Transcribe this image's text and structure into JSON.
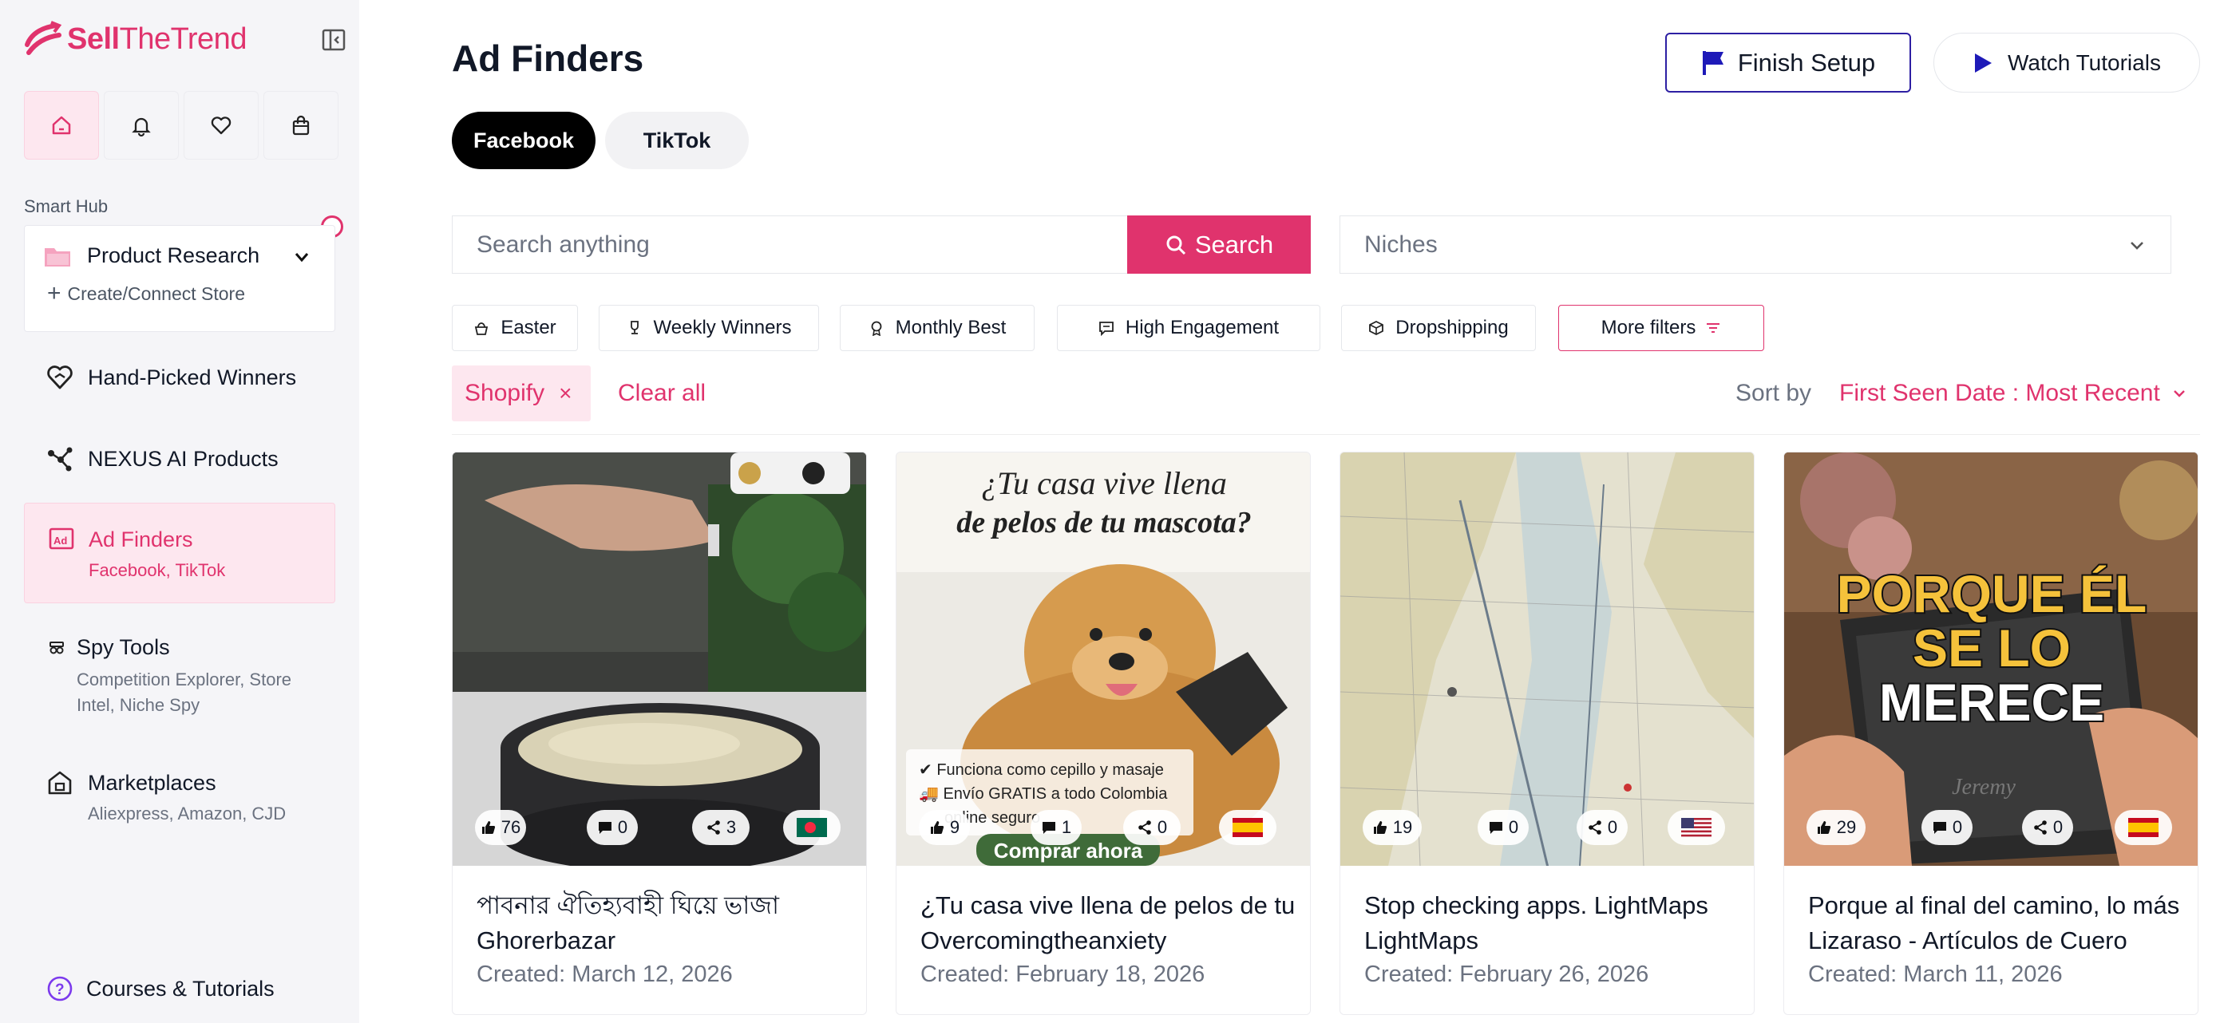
{
  "brand": {
    "logo_text_bold": "Sell",
    "logo_text_thin": "TheTrend"
  },
  "sidebar": {
    "smart_hub_label": "Smart Hub",
    "product_research": {
      "title": "Product Research",
      "sub": "Create/Connect Store"
    },
    "items": [
      {
        "title": "Hand-Picked Winners",
        "sub": ""
      },
      {
        "title": "NEXUS AI Products",
        "sub": ""
      },
      {
        "title": "Ad Finders",
        "sub": "Facebook, TikTok"
      },
      {
        "title": "Spy Tools",
        "sub": "Competition Explorer, Store Intel, Niche Spy"
      },
      {
        "title": "Marketplaces",
        "sub": "Aliexpress, Amazon, CJD"
      },
      {
        "title": "Courses & Tutorials",
        "sub": ""
      }
    ]
  },
  "header": {
    "title": "Ad Finders",
    "finish_setup": "Finish Setup",
    "watch_tutorials": "Watch Tutorials"
  },
  "tabs": [
    "Facebook",
    "TikTok"
  ],
  "search": {
    "placeholder": "Search anything",
    "button": "Search",
    "niches_placeholder": "Niches"
  },
  "chips": [
    "Easter",
    "Weekly Winners",
    "Monthly Best",
    "High Engagement",
    "Dropshipping",
    "More filters"
  ],
  "active_filter": {
    "label": "Shopify",
    "remove": "×"
  },
  "clear_all": "Clear all",
  "sort": {
    "label": "Sort by",
    "value": "First Seen Date : Most Recent"
  },
  "cards": [
    {
      "likes": "76",
      "comments": "0",
      "shares": "3",
      "country": "Bangladesh",
      "title_line1": "পাবনার ঐতিহ্যবাহী ঘিয়ে ভাজা",
      "title_line2": "Ghorerbazar",
      "date": "Created: March 12, 2026"
    },
    {
      "likes": "9",
      "comments": "1",
      "shares": "0",
      "country": "Spain",
      "title_line1": "¿Tu casa vive llena de pelos de tu",
      "title_line2": "Overcomingtheanxiety",
      "date": "Created: February 18, 2026",
      "overlay": {
        "headline_1": "¿Tu casa vive llena",
        "headline_2": "de pelos de tu mascota?",
        "bullet_1": "Funciona como cepillo y masaje",
        "bullet_2": "Envío GRATIS a todo Colombia",
        "bullet_3": "online seguro",
        "cta": "Comprar ahora"
      }
    },
    {
      "likes": "19",
      "comments": "0",
      "shares": "0",
      "country": "United States",
      "title_line1": "Stop checking apps. LightMaps",
      "title_line2": "LightMaps",
      "date": "Created: February 26, 2026"
    },
    {
      "likes": "29",
      "comments": "0",
      "shares": "0",
      "country": "Spain",
      "title_line1": "Porque al final del camino, lo más",
      "title_line2": "Lizaraso - Artículos de Cuero",
      "date": "Created: March 11, 2026",
      "overlay": {
        "line_1": "PORQUE ÉL",
        "line_2": "SE LO",
        "line_3": "MERECE",
        "wallet_name": "Jeremy"
      }
    }
  ],
  "colors": {
    "accent": "#e0336d",
    "accent_light": "#fde7ef",
    "finish_border": "#2d1fa3",
    "sidebar_bg": "#f5f5f8"
  }
}
